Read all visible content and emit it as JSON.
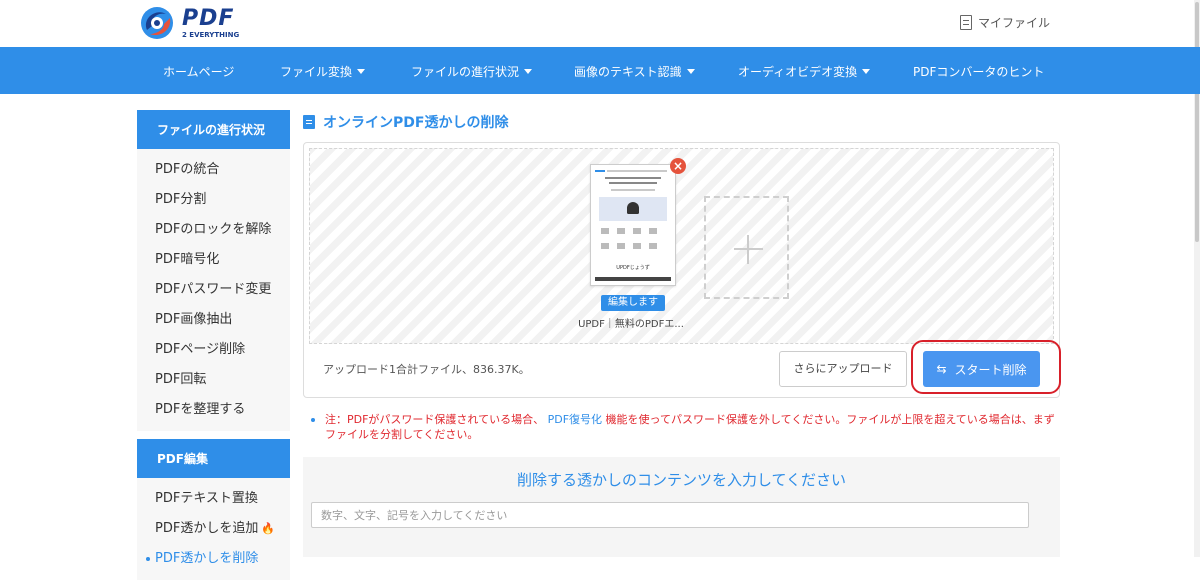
{
  "brand": {
    "logo_text": "PDF",
    "logo_sub": "2 EVERYTHING"
  },
  "header": {
    "my_files": "マイファイル"
  },
  "nav": {
    "items": [
      {
        "label": "ホームページ",
        "dropdown": false
      },
      {
        "label": "ファイル変換",
        "dropdown": true
      },
      {
        "label": "ファイルの進行状況",
        "dropdown": true
      },
      {
        "label": "画像のテキスト認識",
        "dropdown": true
      },
      {
        "label": "オーディオビデオ変換",
        "dropdown": true
      },
      {
        "label": "PDFコンバータのヒント",
        "dropdown": false
      }
    ]
  },
  "sidebar": {
    "section1_title": "ファイルの進行状況",
    "section1_items": [
      {
        "label": "PDFの統合"
      },
      {
        "label": "PDF分割"
      },
      {
        "label": "PDFのロックを解除"
      },
      {
        "label": "PDF暗号化"
      },
      {
        "label": "PDFパスワード変更"
      },
      {
        "label": "PDF画像抽出"
      },
      {
        "label": "PDFページ削除"
      },
      {
        "label": "PDF回転"
      },
      {
        "label": "PDFを整理する"
      }
    ],
    "section2_title": "PDF編集",
    "section2_items": [
      {
        "label": "PDFテキスト置換"
      },
      {
        "label": "PDF透かしを追加",
        "hot": true
      },
      {
        "label": "PDF透かしを削除",
        "active": true
      }
    ]
  },
  "main": {
    "title": "オンラインPDF透かしの削除",
    "file": {
      "thumb_caption": "UPDFじょうず",
      "edit_label": "編集します",
      "name": "UPDF｜無料のPDFエ..."
    },
    "upload_info": "アップロード1合計ファイル、836.37K。",
    "more_upload_label": "さらにアップロード",
    "start_label": "スタート削除",
    "note": {
      "prefix": "注：PDFがパスワード保護されている場合、",
      "link": "PDF復号化",
      "suffix": "機能を使ってパスワード保護を外してください。ファイルが上限を超えている場合は、まずファイルを分割してください。"
    },
    "watermark_input": {
      "title": "削除する透かしのコンテンツを入力してください",
      "placeholder": "数字、文字、記号を入力してください",
      "value": ""
    }
  },
  "colors": {
    "accent": "#2f8ee8",
    "highlight": "#d8202a",
    "warning_text": "#e0282f"
  }
}
